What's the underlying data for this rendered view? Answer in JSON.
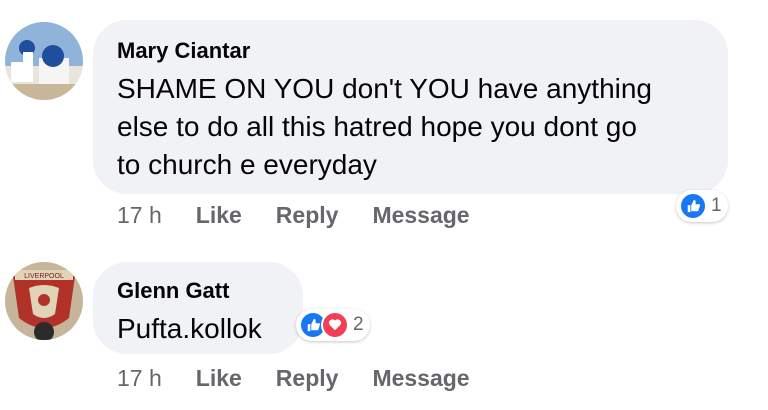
{
  "comments": [
    {
      "author": "Mary Ciantar",
      "lines": [
        "SHAME ON YOU don't YOU have anything",
        "else to do all this hatred hope you dont go",
        "to church e everyday"
      ],
      "time": "17 h",
      "like_label": "Like",
      "reply_label": "Reply",
      "message_label": "Message",
      "reaction_count": "1",
      "reactions": [
        "like-icon"
      ]
    },
    {
      "author": "Glenn Gatt",
      "lines": [
        "Pufta.kollok"
      ],
      "avatar_text": "LIVERPOOL",
      "time": "17 h",
      "like_label": "Like",
      "reply_label": "Reply",
      "message_label": "Message",
      "reaction_count": "2",
      "reactions": [
        "like-icon",
        "love-icon"
      ]
    }
  ],
  "colors": {
    "bubble": "#f0f2f5",
    "like_blue": "#1877f2",
    "love_red": "#f33e58",
    "meta_gray": "#65676b"
  }
}
